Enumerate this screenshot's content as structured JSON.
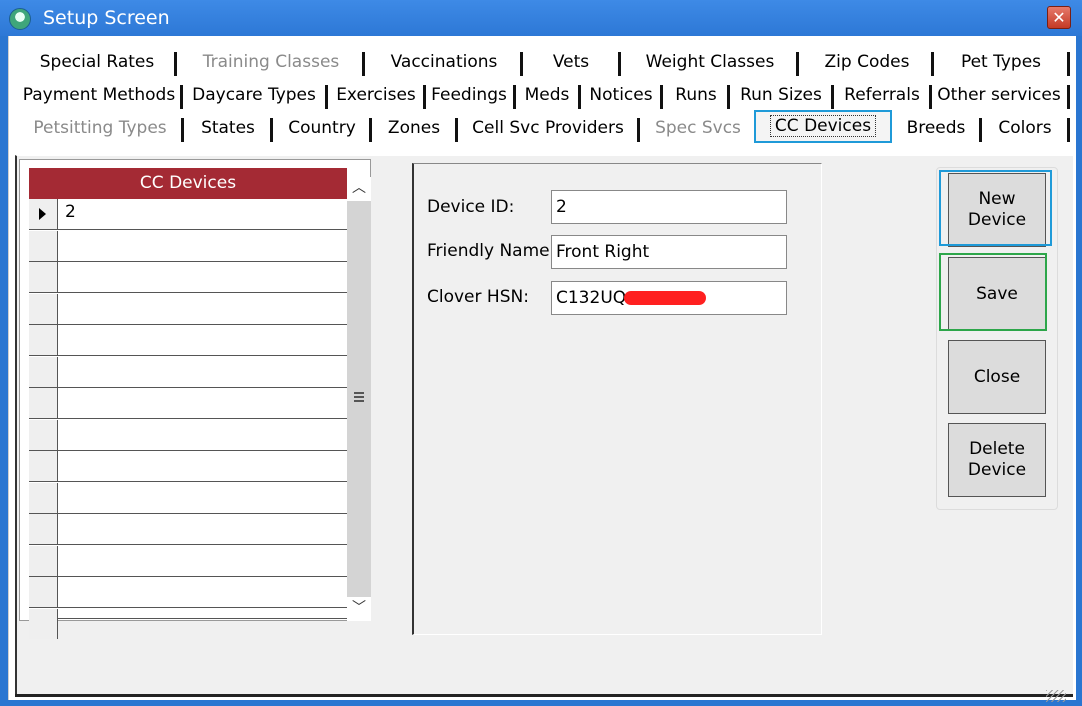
{
  "window": {
    "title": "Setup Screen",
    "close_glyph": "✕"
  },
  "tabs": {
    "row1": [
      "Special Rates",
      "Training Classes",
      "Vaccinations",
      "Vets",
      "Weight Classes",
      "Zip Codes",
      "Pet Types"
    ],
    "row2": [
      "Payment Methods",
      "Daycare Types",
      "Exercises",
      "Feedings",
      "Meds",
      "Notices",
      "Runs",
      "Run Sizes",
      "Referrals",
      "Other services"
    ],
    "row3": [
      "Petsitting Types",
      "States",
      "Country",
      "Zones",
      "Cell Svc Providers",
      "Spec Svcs",
      "CC Devices",
      "Breeds",
      "Colors"
    ],
    "active": "CC Devices",
    "disabled": [
      "Training Classes",
      "Petsitting Types",
      "Spec Svcs"
    ]
  },
  "grid": {
    "header": "CC Devices",
    "rows": [
      "2",
      "",
      "",
      "",
      "",
      "",
      "",
      "",
      "",
      "",
      "",
      "",
      "",
      ""
    ]
  },
  "form": {
    "device_id_label": "Device ID:",
    "device_id_value": "2",
    "friendly_name_label": "Friendly Name",
    "friendly_name_value": "Front Right",
    "clover_hsn_label": "Clover HSN:",
    "clover_hsn_value": "C132UQ"
  },
  "buttons": {
    "new_device": "New\nDevice",
    "save": "Save",
    "close": "Close",
    "delete_device": "Delete\nDevice"
  },
  "colors": {
    "titlebar": "#2d78d6",
    "grid_header": "#a42a34",
    "highlight_blue": "#1f9ad8",
    "highlight_green": "#2da64a"
  }
}
